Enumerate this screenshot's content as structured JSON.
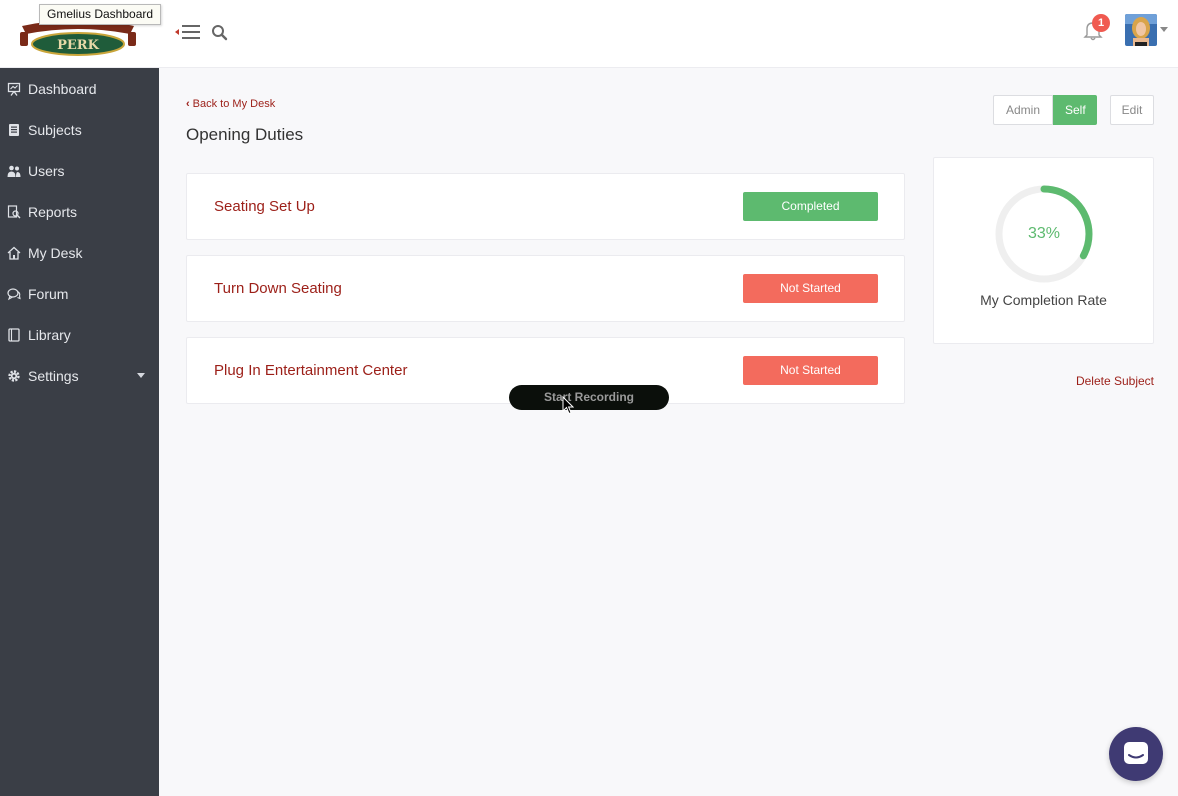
{
  "browser_tooltip": "Gmelius Dashboard",
  "brand": {
    "logo_text": "PERK"
  },
  "topbar": {
    "notifications_count": "1",
    "icons": [
      "hamburger-menu-icon",
      "search-icon",
      "bell-icon",
      "chevron-down-icon"
    ]
  },
  "sidebar": {
    "items": [
      {
        "label": "Dashboard",
        "icon": "presentation-board-icon"
      },
      {
        "label": "Subjects",
        "icon": "book-icon"
      },
      {
        "label": "Users",
        "icon": "users-icon"
      },
      {
        "label": "Reports",
        "icon": "report-magnifier-icon"
      },
      {
        "label": "My Desk",
        "icon": "home-icon"
      },
      {
        "label": "Forum",
        "icon": "chat-bubbles-icon"
      },
      {
        "label": "Library",
        "icon": "library-book-icon"
      },
      {
        "label": "Settings",
        "icon": "gear-icon"
      }
    ]
  },
  "main": {
    "back_link": "Back to My Desk",
    "title": "Opening Duties",
    "role_toggle": {
      "admin": "Admin",
      "self": "Self",
      "selected": "Self"
    },
    "edit_label": "Edit",
    "duties": [
      {
        "title": "Seating Set Up",
        "status": "Completed",
        "state": "done"
      },
      {
        "title": "Turn Down Seating",
        "status": "Not Started",
        "state": "todo"
      },
      {
        "title": "Plug In Entertainment Center",
        "status": "Not Started",
        "state": "todo"
      }
    ],
    "completion": {
      "percent_label": "33%",
      "fraction": 0.33,
      "label": "My Completion Rate"
    },
    "delete_label": "Delete Subject"
  },
  "overlay": {
    "recording_label": "Start Recording"
  },
  "colors": {
    "sidebar_bg": "#3a3e46",
    "accent_green": "#5dba6f",
    "accent_red": "#f36b5d",
    "link_red": "#9c1f18",
    "chat_purple": "#3f3a73"
  }
}
